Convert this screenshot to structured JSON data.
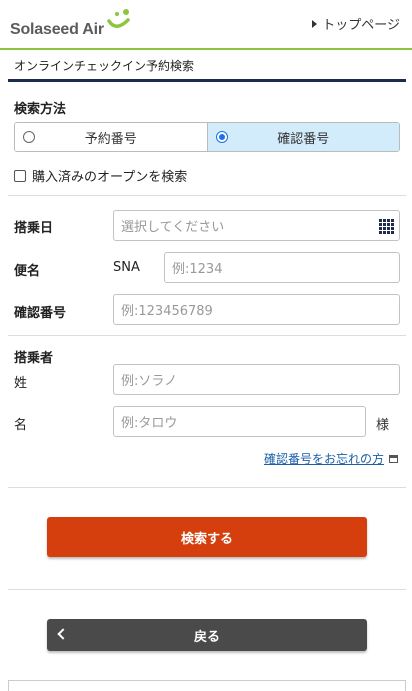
{
  "header": {
    "brand": "Solaseed Air",
    "top_page_link": "トップページ",
    "colors": {
      "accent_green": "#8cc63f",
      "navy": "#1d2b4f"
    }
  },
  "page_title": "オンラインチェックイン予約検索",
  "search_method": {
    "label": "検索方法",
    "options": [
      {
        "label": "予約番号",
        "selected": false
      },
      {
        "label": "確認番号",
        "selected": true
      }
    ],
    "purchased_open_checkbox": {
      "label": "購入済みのオープンを検索",
      "checked": false
    }
  },
  "form": {
    "boarding_date": {
      "label": "搭乗日",
      "placeholder": "選択してください",
      "icon": "calendar-icon"
    },
    "flight": {
      "label": "便名",
      "prefix": "SNA",
      "placeholder": "例:1234"
    },
    "confirmation_number": {
      "label": "確認番号",
      "placeholder": "例:123456789"
    },
    "passenger": {
      "label": "搭乗者",
      "last_name": {
        "label": "姓",
        "placeholder": "例:ソラノ"
      },
      "first_name": {
        "label": "名",
        "placeholder": "例:タロウ",
        "suffix": "様"
      }
    },
    "forgot_link": "確認番号をお忘れの方"
  },
  "buttons": {
    "search": {
      "label": "検索する",
      "color": "#d53f0d"
    },
    "back": {
      "label": "戻る",
      "color": "#4a4a4a"
    }
  }
}
